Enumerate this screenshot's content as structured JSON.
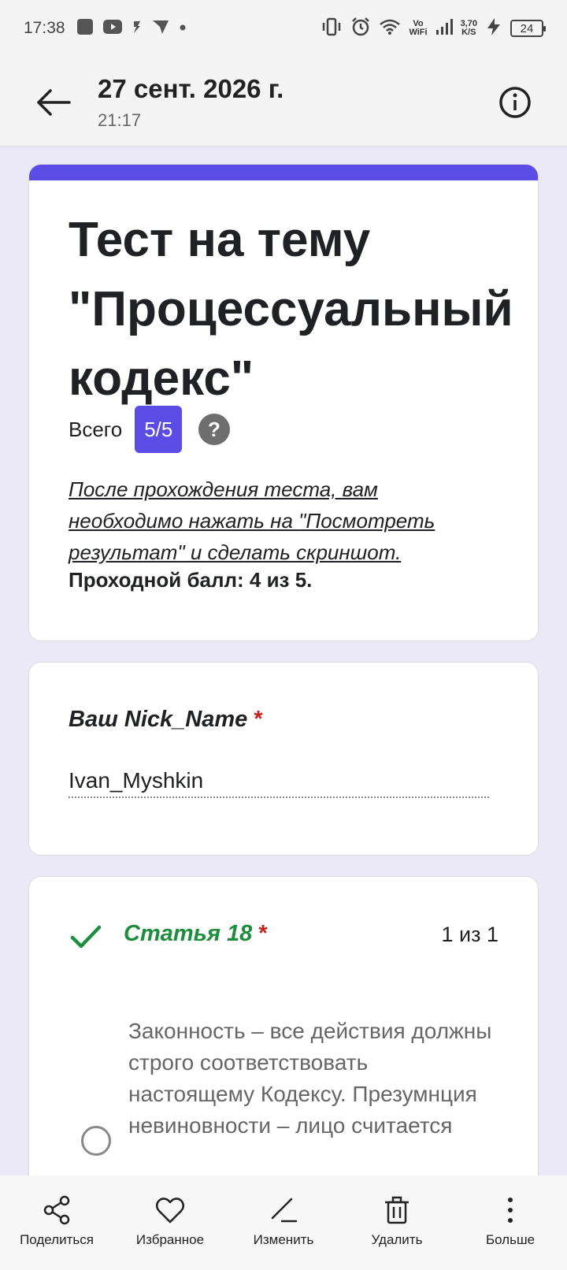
{
  "status_bar": {
    "time": "17:38",
    "volte": "Vo",
    "wifi_label": "WiFi",
    "speed_value": "3,70",
    "speed_unit": "K/S",
    "battery": "24"
  },
  "app_bar": {
    "title": "27 сент. 2026 г.",
    "subtitle": "21:17"
  },
  "form": {
    "title": "Тест на тему \"Процессуальный кодекс\"",
    "score_label": "Всего",
    "score_value": "5/5",
    "description": "После прохождения теста, вам необходимо нажать на \"Посмотреть результат\" и сделать скриншот.",
    "pass_note": "Проходной балл: 4 из 5.",
    "accent_color": "#5b4ce6"
  },
  "nick_question": {
    "label": "Ваш Nick_Name",
    "required_mark": "*",
    "answer": "Ivan_Myshkin"
  },
  "question1": {
    "title": "Статья 18",
    "required_mark": "*",
    "score": "1 из 1",
    "option_text": "Законность – все действия должны строго соответствовать настоящему Кодексу. Презумнция невиновности – лицо считается"
  },
  "bottom_bar": {
    "items": [
      {
        "label": "Поделиться",
        "icon": "share-icon"
      },
      {
        "label": "Избранное",
        "icon": "heart-icon"
      },
      {
        "label": "Изменить",
        "icon": "edit-icon"
      },
      {
        "label": "Удалить",
        "icon": "trash-icon"
      },
      {
        "label": "Больше",
        "icon": "more-vert-icon"
      }
    ]
  }
}
